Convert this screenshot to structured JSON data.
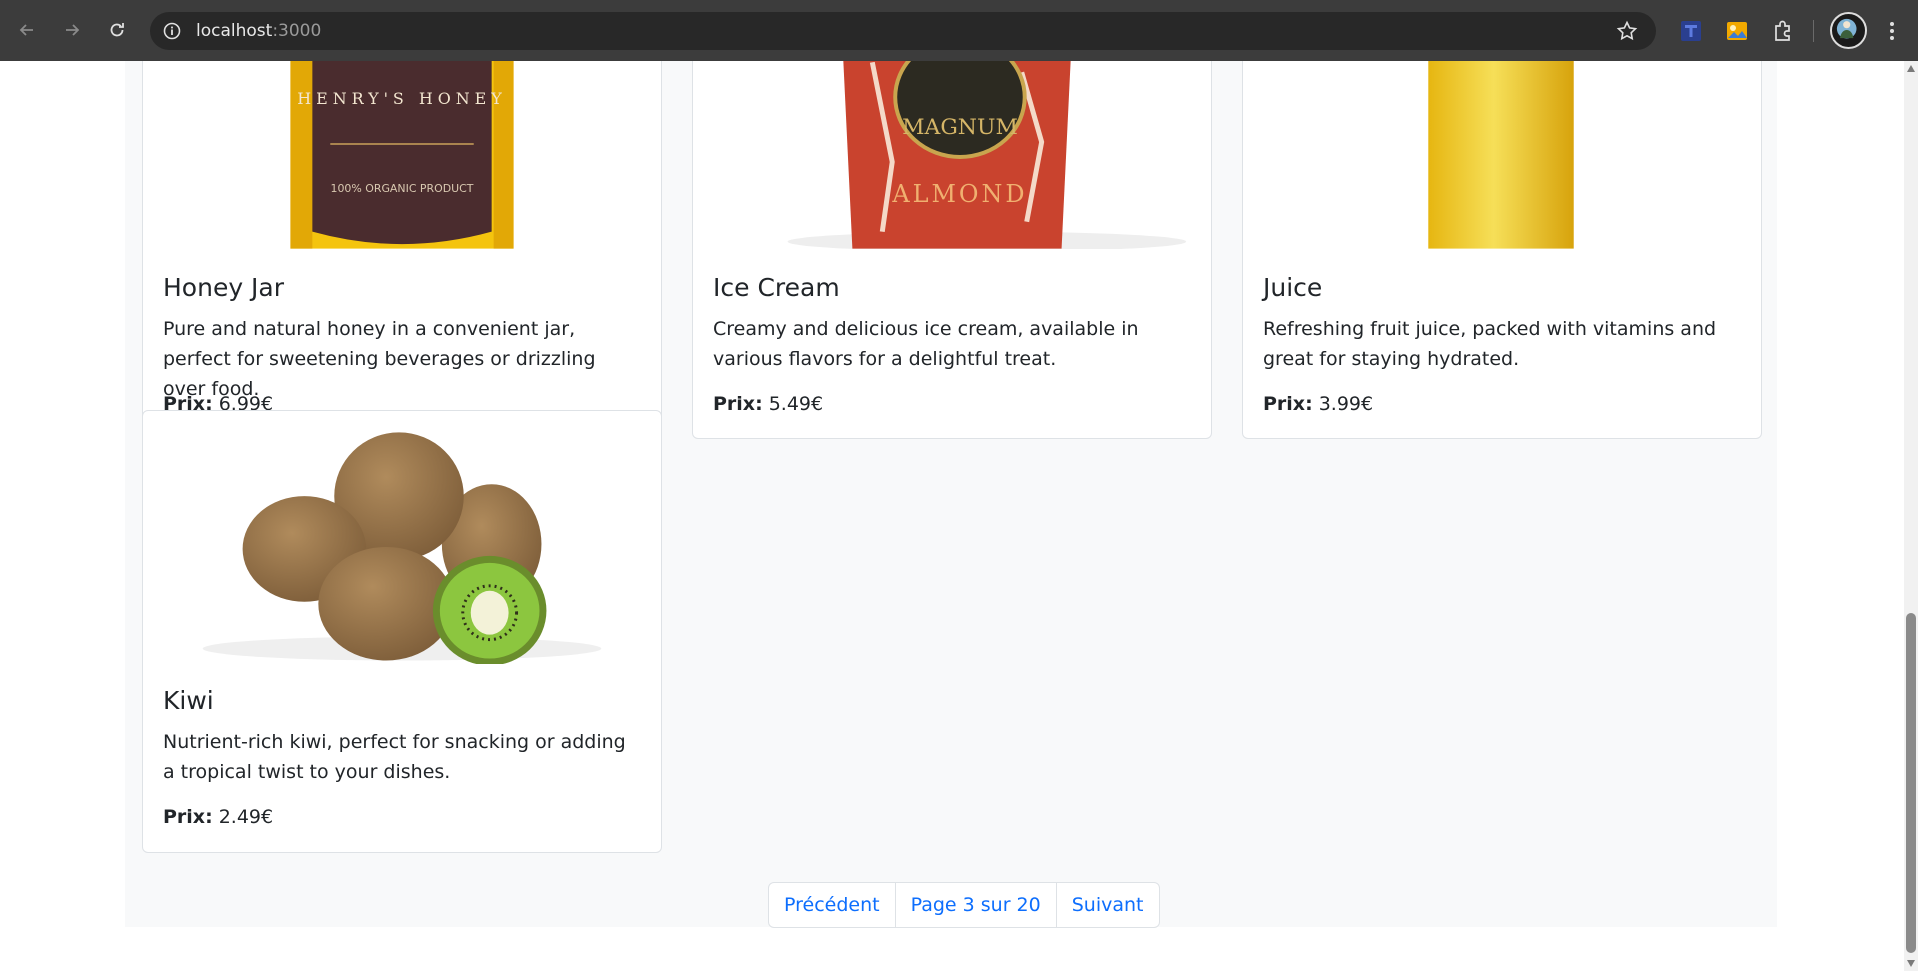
{
  "browser": {
    "url_host": "localhost",
    "url_port": ":3000"
  },
  "products": [
    {
      "title": "Honey Jar",
      "description": "Pure and natural honey in a convenient jar, perfect for sweetening beverages or drizzling over food.",
      "price_label": "Prix:",
      "price": "6.99€",
      "image_icon": "honey-jar-image"
    },
    {
      "title": "Ice Cream",
      "description": "Creamy and delicious ice cream, available in various flavors for a delightful treat.",
      "price_label": "Prix:",
      "price": "5.49€",
      "image_icon": "ice-cream-image"
    },
    {
      "title": "Juice",
      "description": "Refreshing fruit juice, packed with vitamins and great for staying hydrated.",
      "price_label": "Prix:",
      "price": "3.99€",
      "image_icon": "juice-image"
    },
    {
      "title": "Kiwi",
      "description": "Nutrient-rich kiwi, perfect for snacking or adding a tropical twist to your dishes.",
      "price_label": "Prix:",
      "price": "2.49€",
      "image_icon": "kiwi-image"
    }
  ],
  "image_text": {
    "honey_brand": "HENRY'S HONEY",
    "honey_tag": "100% ORGANIC PRODUCT",
    "icecream_brand": "MAGNUM",
    "icecream_flavor": "ALMOND"
  },
  "pagination": {
    "prev": "Précédent",
    "page_info": "Page 3 sur 20",
    "next": "Suivant"
  },
  "colors": {
    "link": "#0d6efd",
    "page_bg": "#f8f9fa",
    "chrome_bg": "#3c3c3c"
  }
}
